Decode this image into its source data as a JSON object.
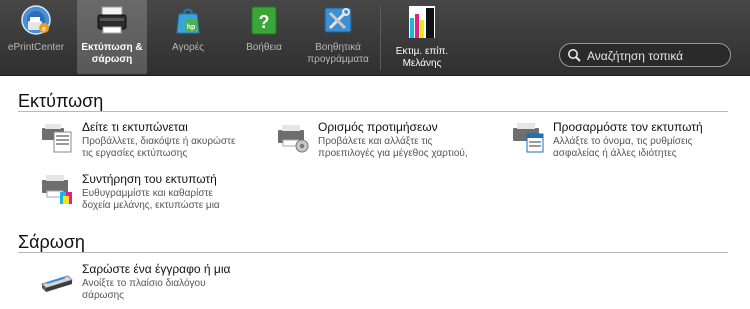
{
  "toolbar": {
    "eprintcenter": "ePrintCenter",
    "print_scan": [
      "Εκτύπωση &",
      "σάρωση"
    ],
    "shop": "Αγορές",
    "help": "Βοήθεια",
    "utilities": [
      "Βοηθητικά",
      "προγράμματα"
    ],
    "ink": [
      "Εκτιμ. επίπ.",
      "Μελάνης"
    ]
  },
  "search": {
    "placeholder": "Αναζήτηση τοπικά"
  },
  "print_section": {
    "title": "Εκτύπωση",
    "items": [
      {
        "title": "Δείτε τι εκτυπώνεται",
        "desc": [
          "Προβάλλετε, διακόψτε ή ακυρώστε",
          "τις εργασίες εκτύπωσης"
        ],
        "icon": "printer-queue-icon"
      },
      {
        "title": "Ορισμός προτιμήσεων",
        "desc": [
          "Προβάλετε και αλλάξτε τις",
          "προεπιλογές για μέγεθος χαρτιού,"
        ],
        "icon": "printer-preferences-icon"
      },
      {
        "title": "Προσαρμόστε τον εκτυπωτή",
        "desc": [
          "Αλλάξτε το όνομα, τις ρυθμίσεις",
          "ασφαλείας ή άλλες ιδιότητες"
        ],
        "icon": "printer-customize-icon"
      },
      {
        "title": "Συντήρηση του εκτυπωτή",
        "desc": [
          "Ευθυγραμμίστε και καθαρίστε",
          "δοχεία μελάνης, εκτυπώστε μια"
        ],
        "icon": "printer-maintenance-icon"
      }
    ]
  },
  "scan_section": {
    "title": "Σάρωση",
    "items": [
      {
        "title": "Σαρώστε ένα έγγραφο ή μια",
        "desc": [
          "Ανοίξτε το πλαίσιο διαλόγου",
          "σάρωσης"
        ],
        "icon": "scanner-icon"
      }
    ]
  },
  "colors": {
    "toolbar_bg": "#3a3a3a",
    "active_tab": "#626262",
    "rule": "#b9b9b9"
  }
}
